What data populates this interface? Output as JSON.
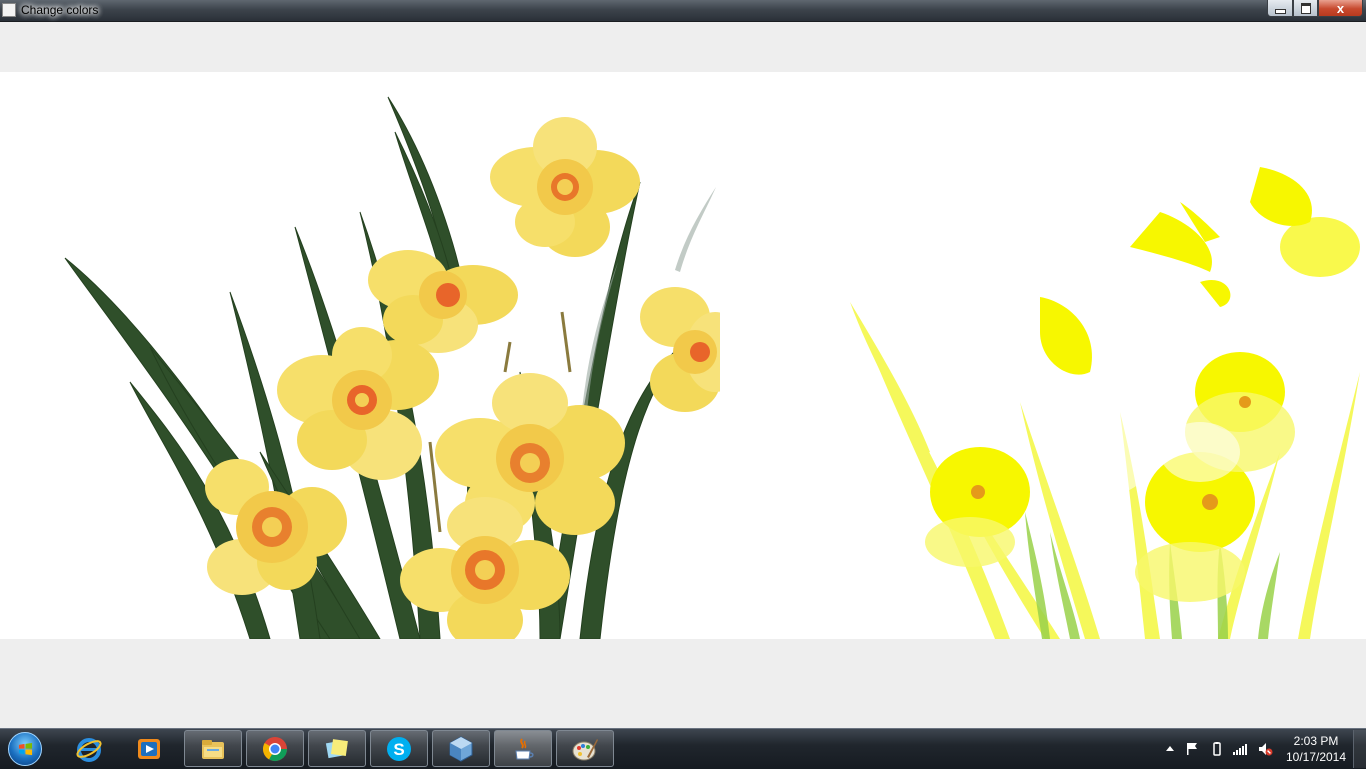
{
  "window": {
    "title": "Change colors",
    "controls": {
      "minimize": "minimize",
      "maximize": "maximize",
      "close": "x"
    }
  },
  "images": {
    "original": "daffodils-original",
    "filtered": "daffodils-filtered"
  },
  "taskbar": {
    "start": "start-orb",
    "items": [
      {
        "name": "internet-explorer",
        "state": "pinned"
      },
      {
        "name": "windows-media-player",
        "state": "pinned"
      },
      {
        "name": "windows-explorer",
        "state": "running"
      },
      {
        "name": "google-chrome",
        "state": "running"
      },
      {
        "name": "sticky-notes",
        "state": "running"
      },
      {
        "name": "skype",
        "state": "running"
      },
      {
        "name": "virtualbox",
        "state": "running"
      },
      {
        "name": "java",
        "state": "active"
      },
      {
        "name": "paint",
        "state": "running"
      }
    ]
  },
  "tray": {
    "icons": [
      "show-hidden-icons",
      "action-center-flag",
      "power",
      "network-signal",
      "volume-muted"
    ],
    "time": "2:03 PM",
    "date": "10/17/2014"
  },
  "colors": {
    "titlebar": "#3d444c",
    "content_bg": "#eeeeee",
    "canvas_bg": "#ffffff",
    "taskbar": "#20262d"
  }
}
